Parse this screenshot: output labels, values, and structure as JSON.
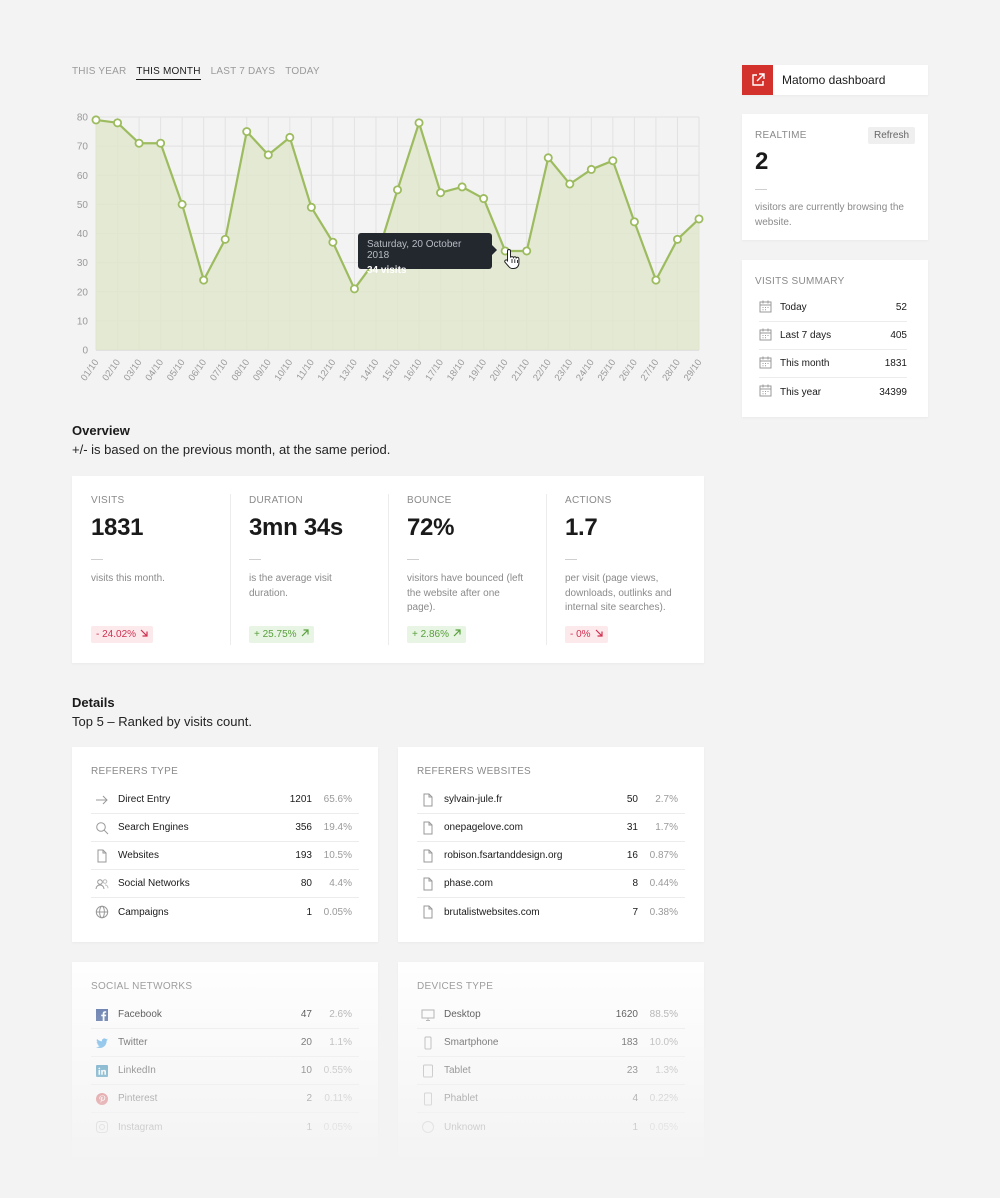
{
  "tabs": [
    "THIS YEAR",
    "THIS MONTH",
    "LAST 7 DAYS",
    "TODAY"
  ],
  "active_tab": "THIS MONTH",
  "chart_data": {
    "type": "area",
    "x": [
      "01/10",
      "02/10",
      "03/10",
      "04/10",
      "05/10",
      "06/10",
      "07/10",
      "08/10",
      "09/10",
      "10/10",
      "11/10",
      "12/10",
      "13/10",
      "14/10",
      "15/10",
      "16/10",
      "17/10",
      "18/10",
      "19/10",
      "20/10",
      "21/10",
      "22/10",
      "23/10",
      "24/10",
      "25/10",
      "26/10",
      "27/10",
      "28/10",
      "29/10"
    ],
    "values": [
      79,
      78,
      71,
      71,
      50,
      24,
      38,
      75,
      67,
      73,
      49,
      37,
      21,
      31,
      55,
      78,
      54,
      56,
      52,
      34,
      34,
      66,
      57,
      62,
      65,
      44,
      24,
      38,
      45
    ],
    "ylim": [
      0,
      80
    ],
    "yticks": [
      0,
      10,
      20,
      30,
      40,
      50,
      60,
      70,
      80
    ],
    "grid": true,
    "colors": {
      "line": "#9dbb5f",
      "fill": "#dfe6cb"
    },
    "tooltip": {
      "date": "Saturday, 20 October 2018",
      "value": "34 visits",
      "index": 19
    }
  },
  "overview": {
    "title": "Overview",
    "subtitle": "+/- is based on the previous month, at the same period.",
    "metrics": [
      {
        "label": "VISITS",
        "value": "1831",
        "desc": "visits this month.",
        "change": "- 24.02%",
        "trend": "down"
      },
      {
        "label": "DURATION",
        "value": "3mn 34s",
        "desc": "is the average visit duration.",
        "change": "+ 25.75%",
        "trend": "up"
      },
      {
        "label": "BOUNCE",
        "value": "72%",
        "desc": "visitors have bounced (left the website after one page).",
        "change": "+ 2.86%",
        "trend": "up"
      },
      {
        "label": "ACTIONS",
        "value": "1.7",
        "desc": "per visit (page views, downloads, outlinks and internal site searches).",
        "change": "- 0%",
        "trend": "down"
      }
    ]
  },
  "sidebar": {
    "dashboard_link": "Matomo dashboard",
    "realtime": {
      "label": "REALTIME",
      "refresh": "Refresh",
      "value": "2",
      "desc": "visitors are currently browsing the website."
    },
    "summary": {
      "label": "VISITS SUMMARY",
      "rows": [
        {
          "name": "Today",
          "value": "52"
        },
        {
          "name": "Last 7 days",
          "value": "405"
        },
        {
          "name": "This month",
          "value": "1831"
        },
        {
          "name": "This year",
          "value": "34399"
        }
      ]
    }
  },
  "details": {
    "title": "Details",
    "subtitle": "Top 5 – Ranked by visits count.",
    "referers_type": {
      "title": "REFERERS TYPE",
      "rows": [
        {
          "icon": "arrow-right-icon",
          "name": "Direct Entry",
          "count": "1201",
          "pct": "65.6%"
        },
        {
          "icon": "search-icon",
          "name": "Search Engines",
          "count": "356",
          "pct": "19.4%"
        },
        {
          "icon": "document-icon",
          "name": "Websites",
          "count": "193",
          "pct": "10.5%"
        },
        {
          "icon": "users-icon",
          "name": "Social Networks",
          "count": "80",
          "pct": "4.4%"
        },
        {
          "icon": "globe-icon",
          "name": "Campaigns",
          "count": "1",
          "pct": "0.05%"
        }
      ]
    },
    "referers_websites": {
      "title": "REFERERS WEBSITES",
      "rows": [
        {
          "icon": "document-icon",
          "name": "sylvain-jule.fr",
          "count": "50",
          "pct": "2.7%"
        },
        {
          "icon": "document-icon",
          "name": "onepagelove.com",
          "count": "31",
          "pct": "1.7%"
        },
        {
          "icon": "document-icon",
          "name": "robison.fsartanddesign.org",
          "count": "16",
          "pct": "0.87%"
        },
        {
          "icon": "document-icon",
          "name": "phase.com",
          "count": "8",
          "pct": "0.44%"
        },
        {
          "icon": "document-icon",
          "name": "brutalistwebsites.com",
          "count": "7",
          "pct": "0.38%"
        }
      ]
    },
    "social_networks": {
      "title": "SOCIAL NETWORKS",
      "rows": [
        {
          "icon": "facebook-icon",
          "name": "Facebook",
          "count": "47",
          "pct": "2.6%"
        },
        {
          "icon": "twitter-icon",
          "name": "Twitter",
          "count": "20",
          "pct": "1.1%"
        },
        {
          "icon": "linkedin-icon",
          "name": "LinkedIn",
          "count": "10",
          "pct": "0.55%"
        },
        {
          "icon": "pinterest-icon",
          "name": "Pinterest",
          "count": "2",
          "pct": "0.11%"
        },
        {
          "icon": "instagram-icon",
          "name": "Instagram",
          "count": "1",
          "pct": "0.05%"
        }
      ]
    },
    "devices_type": {
      "title": "DEVICES TYPE",
      "rows": [
        {
          "icon": "desktop-icon",
          "name": "Desktop",
          "count": "1620",
          "pct": "88.5%"
        },
        {
          "icon": "smartphone-icon",
          "name": "Smartphone",
          "count": "183",
          "pct": "10.0%"
        },
        {
          "icon": "tablet-icon",
          "name": "Tablet",
          "count": "23",
          "pct": "1.3%"
        },
        {
          "icon": "phablet-icon",
          "name": "Phablet",
          "count": "4",
          "pct": "0.22%"
        },
        {
          "icon": "unknown-icon",
          "name": "Unknown",
          "count": "1",
          "pct": "0.05%"
        }
      ]
    }
  }
}
